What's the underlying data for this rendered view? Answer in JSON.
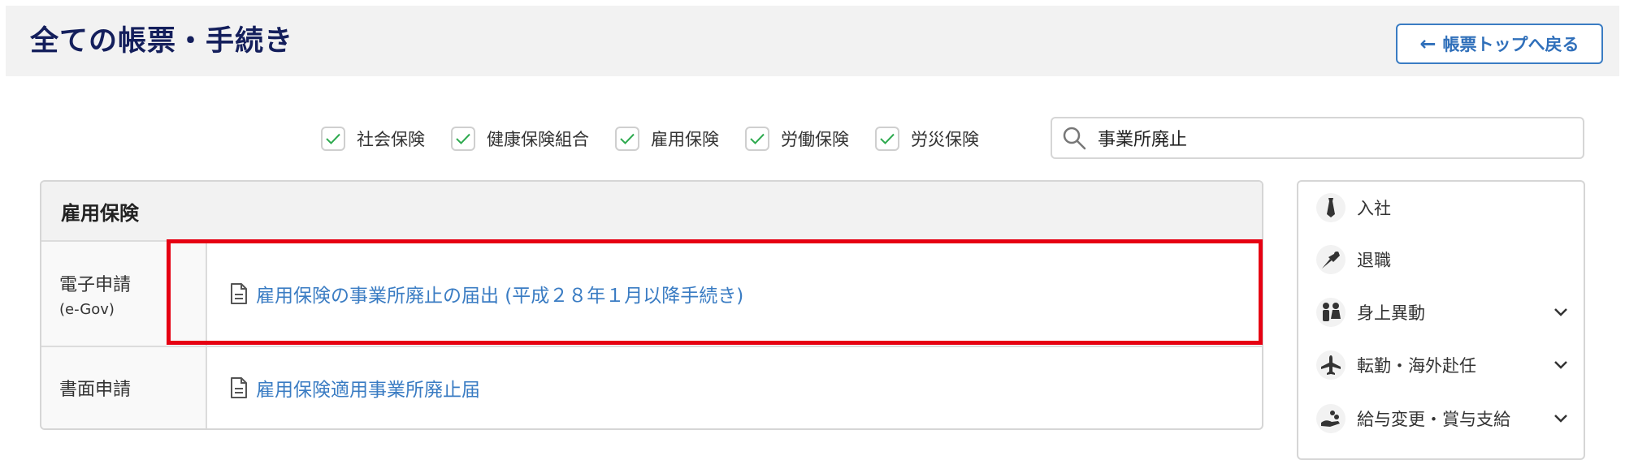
{
  "header": {
    "title": "全ての帳票・手続き",
    "back_button": "帳票トップへ戻る"
  },
  "filters": [
    {
      "label": "社会保険",
      "checked": true
    },
    {
      "label": "健康保険組合",
      "checked": true
    },
    {
      "label": "雇用保険",
      "checked": true
    },
    {
      "label": "労働保険",
      "checked": true
    },
    {
      "label": "労災保険",
      "checked": true
    }
  ],
  "search": {
    "value": "事業所廃止"
  },
  "panel": {
    "title": "雇用保険",
    "rows": [
      {
        "label": "電子申請",
        "sublabel": "(e-Gov)",
        "link": "雇用保険の事業所廃止の届出 (平成２８年１月以降手続き)"
      },
      {
        "label": "書面申請",
        "link": "雇用保険適用事業所廃止届"
      }
    ]
  },
  "sidebar": {
    "items": [
      {
        "label": "入社",
        "icon": "tie-icon",
        "expandable": false
      },
      {
        "label": "退職",
        "icon": "bouquet-icon",
        "expandable": false
      },
      {
        "label": "身上異動",
        "icon": "couple-icon",
        "expandable": true
      },
      {
        "label": "転勤・海外赴任",
        "icon": "airplane-icon",
        "expandable": true
      },
      {
        "label": "給与変更・賞与支給",
        "icon": "money-hand-icon",
        "expandable": true
      }
    ]
  },
  "colors": {
    "title": "#141f5c",
    "link": "#3a7cc3",
    "highlight": "#e60012",
    "check": "#2eaa4f"
  }
}
